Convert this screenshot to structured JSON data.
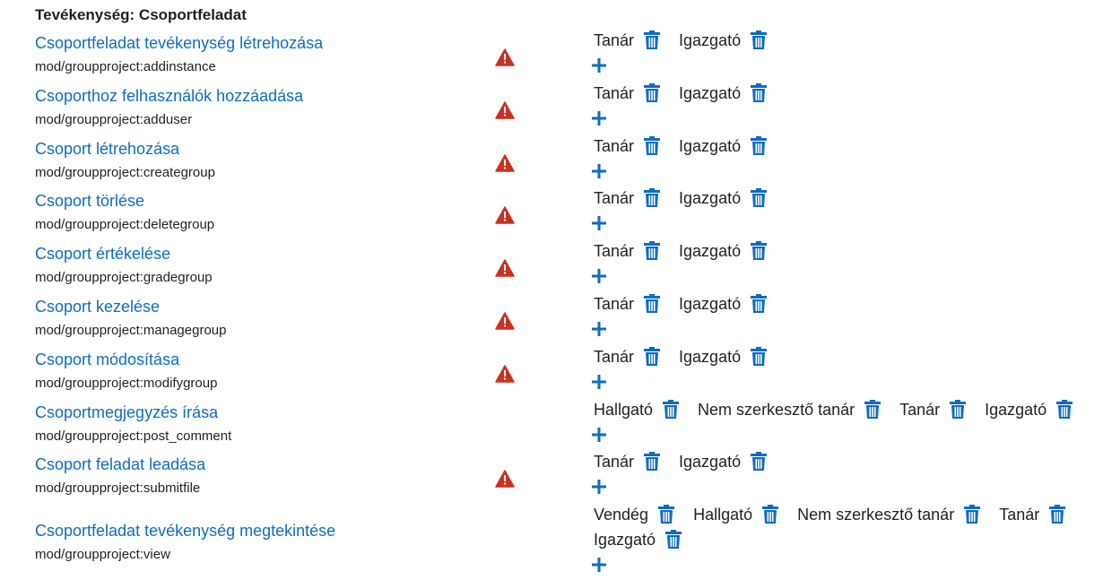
{
  "section": {
    "title": "Tevékenység: Csoportfeladat"
  },
  "colors": {
    "link": "#0f6cbf",
    "risk": "#ca3120",
    "icon": "#0f6cbf"
  },
  "icons": {
    "risk": "risk-warning-icon",
    "remove": "trash-icon",
    "add": "plus-icon"
  },
  "capabilities": [
    {
      "title": "Csoportfeladat tevékenység létrehozása",
      "name": "mod/groupproject:addinstance",
      "risk": true,
      "roles": [
        "Tanár",
        "Igazgató"
      ]
    },
    {
      "title": "Csoporthoz felhasználók hozzáadása",
      "name": "mod/groupproject:adduser",
      "risk": true,
      "roles": [
        "Tanár",
        "Igazgató"
      ]
    },
    {
      "title": "Csoport létrehozása",
      "name": "mod/groupproject:creategroup",
      "risk": true,
      "roles": [
        "Tanár",
        "Igazgató"
      ]
    },
    {
      "title": "Csoport törlése",
      "name": "mod/groupproject:deletegroup",
      "risk": true,
      "roles": [
        "Tanár",
        "Igazgató"
      ]
    },
    {
      "title": "Csoport értékelése",
      "name": "mod/groupproject:gradegroup",
      "risk": true,
      "roles": [
        "Tanár",
        "Igazgató"
      ]
    },
    {
      "title": "Csoport kezelése",
      "name": "mod/groupproject:managegroup",
      "risk": true,
      "roles": [
        "Tanár",
        "Igazgató"
      ]
    },
    {
      "title": "Csoport módosítása",
      "name": "mod/groupproject:modifygroup",
      "risk": true,
      "roles": [
        "Tanár",
        "Igazgató"
      ]
    },
    {
      "title": "Csoportmegjegyzés írása",
      "name": "mod/groupproject:post_comment",
      "risk": false,
      "roles": [
        "Hallgató",
        "Nem szerkesztő tanár",
        "Tanár",
        "Igazgató"
      ]
    },
    {
      "title": "Csoport feladat leadása",
      "name": "mod/groupproject:submitfile",
      "risk": true,
      "roles": [
        "Tanár",
        "Igazgató"
      ]
    },
    {
      "title": "Csoportfeladat tevékenység megtekintése",
      "name": "mod/groupproject:view",
      "risk": false,
      "roles": [
        "Vendég",
        "Hallgató",
        "Nem szerkesztő tanár",
        "Tanár"
      ],
      "roles_line2": [
        "Igazgató"
      ]
    }
  ]
}
